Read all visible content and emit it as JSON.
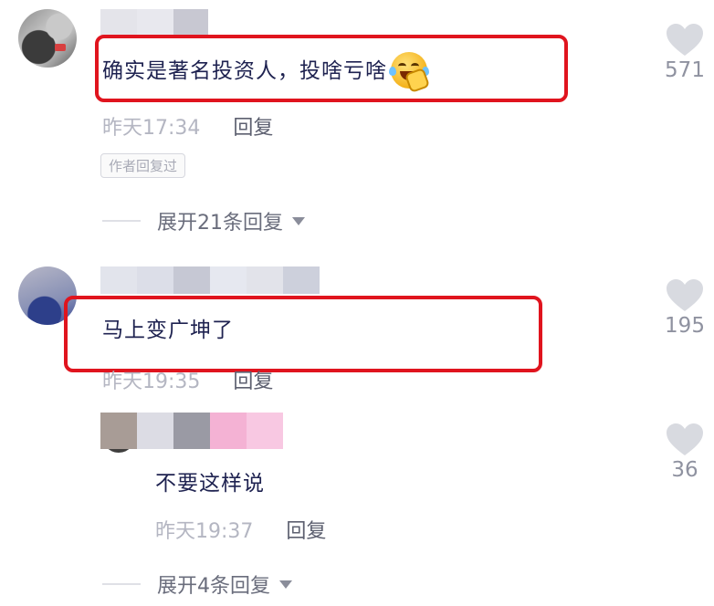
{
  "comments": [
    {
      "text": "确实是著名投资人，投啥亏啥",
      "emoji_icon": "laugh-cry-emoji",
      "time": "昨天17:34",
      "reply_label": "回复",
      "author_tag": "作者回复过",
      "expand_label": "展开21条回复",
      "likes": "571",
      "name_blur_colors": [
        "#e4e4ea",
        "#e8e8ee",
        "#c8c8d2"
      ]
    },
    {
      "text": "马上变广坤了",
      "time": "昨天19:35",
      "reply_label": "回复",
      "likes": "195",
      "name_blur_colors": [
        "#e2e4ec",
        "#dcdee8",
        "#c6c8d4",
        "#e6e8f0",
        "#e2e3ea",
        "#cdd0dc"
      ]
    },
    {
      "text": "不要这样说",
      "time": "昨天19:37",
      "reply_label": "回复",
      "expand_label": "展开4条回复",
      "likes": "36",
      "name_blur_colors": [
        "#a89c96",
        "#dcdce4",
        "#9a9aa4",
        "#f4b2d4",
        "#f8c8e2"
      ]
    }
  ],
  "colors": {
    "highlight": "#e0141e",
    "heart": "#d8dae0"
  }
}
